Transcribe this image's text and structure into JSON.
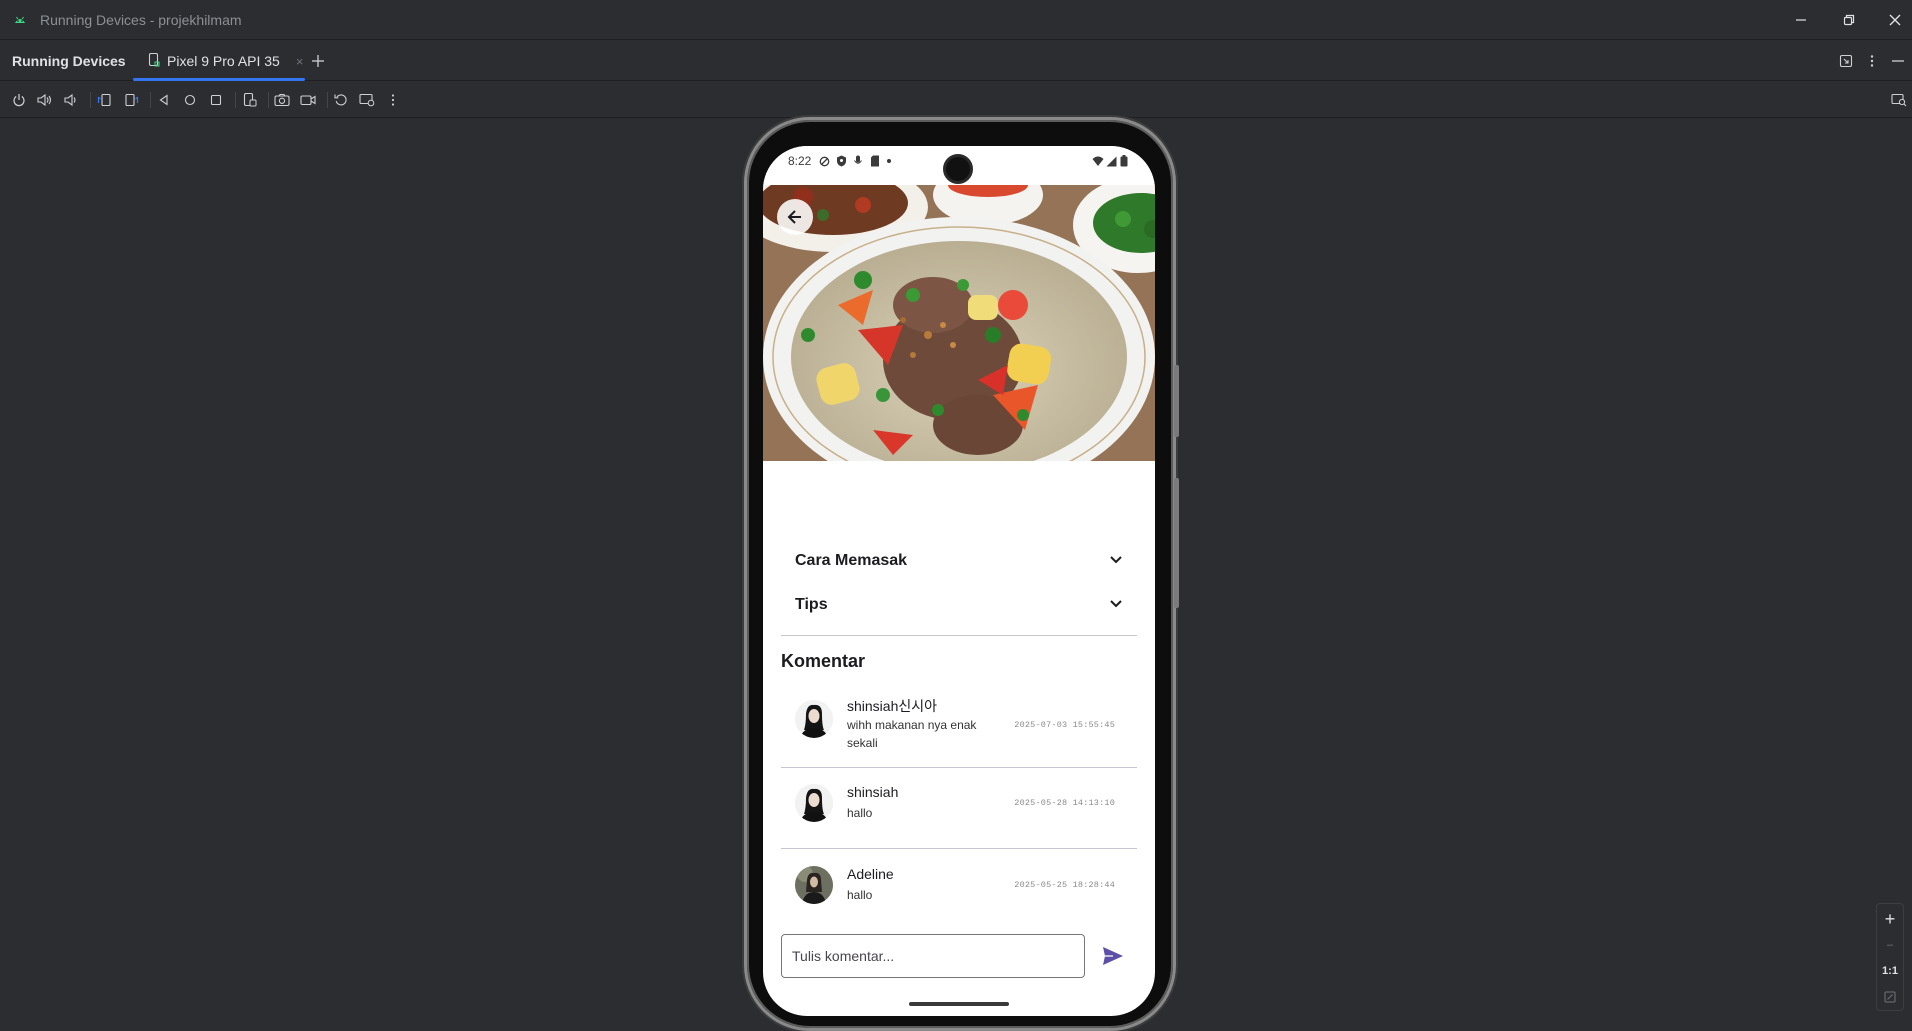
{
  "window": {
    "title": "Running Devices - projekhilmam",
    "accent": "#3574f0"
  },
  "panel": {
    "title": "Running Devices",
    "tabs": [
      {
        "label": "Pixel 9 Pro API 35",
        "close": "×"
      }
    ],
    "add_tab": "+"
  },
  "toolbar": {
    "icons": [
      "power-icon",
      "volume-up-icon",
      "volume-down-icon",
      "rotate-left-icon",
      "rotate-right-icon",
      "back-icon",
      "home-icon",
      "overview-icon",
      "device-frame-icon",
      "screenshot-icon",
      "screen-record-icon",
      "reset-icon",
      "extended-controls-icon",
      "more-icon"
    ]
  },
  "zoom": {
    "plus": "+",
    "minus": "–",
    "actual": "1:1"
  },
  "phone": {
    "status": {
      "time": "8:22"
    },
    "sections": [
      {
        "label": "Cara Memasak"
      },
      {
        "label": "Tips"
      }
    ],
    "comments_title": "Komentar",
    "comments": [
      {
        "name": "shinsiah신시아",
        "text": "wihh makanan nya enak sekali",
        "time": "2025-07-03 15:55:45"
      },
      {
        "name": "shinsiah",
        "text": "hallo",
        "time": "2025-05-28 14:13:10"
      },
      {
        "name": "Adeline",
        "text": "hallo",
        "time": "2025-05-25 18:28:44"
      }
    ],
    "input": {
      "placeholder": "Tulis komentar..."
    },
    "colors": {
      "send": "#5b50a8",
      "surface": "#ffffff"
    }
  }
}
